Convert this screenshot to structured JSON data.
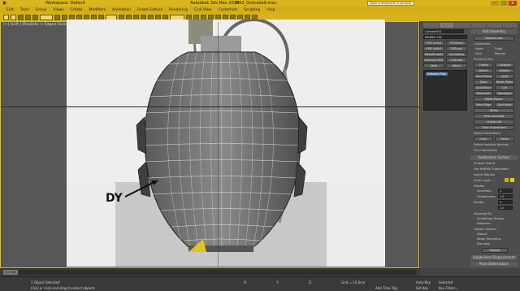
{
  "app": {
    "title": "Autodesk 3ds Max 2016",
    "file": "MK2_Grenade9.max",
    "workspace": "Workspace: Default",
    "search_placeholder": "Type a keyword or phrase"
  },
  "menu": [
    "Edit",
    "Tools",
    "Group",
    "Views",
    "Create",
    "Modifiers",
    "Animation",
    "Graph Editors",
    "Rendering",
    "Civil View",
    "Customize",
    "Scripting",
    "Help"
  ],
  "viewport": {
    "label": "[+] [Left ] [Realistic + Edged Faces ]",
    "annotation": "DY"
  },
  "panel": {
    "object_name": "Cylinder001",
    "modifier_list": "Modifier List",
    "buttons": [
      "FFD 2x2x2",
      "FFD(box)",
      "FFD 3x3x3",
      "FFD(cyl)",
      "TurboSmooth",
      "Symmetry",
      "Unwrap UVW",
      "Chamfer",
      "Shell",
      "Bend"
    ],
    "stack_item": "Editable Poly",
    "edit_geometry": "Edit Geometry",
    "repeat_last": "Repeat Last",
    "constraints": "Constraints",
    "constraint_opts": [
      "None",
      "Edge",
      "Face",
      "Normal"
    ],
    "preserve_uvs": "Preserve UVs",
    "create": "Create",
    "collapse": "Collapse",
    "attach": "Attach",
    "detach": "Detach",
    "slice_plane": "Slice Plane",
    "split": "Split",
    "slice": "Slice",
    "reset_plane": "Reset Plane",
    "quickslice": "QuickSlice",
    "cut": "Cut",
    "msmooth": "MSmooth",
    "tessellate": "Tessellate",
    "make_planar": "Make Planar",
    "view_align": "View Align",
    "grid_align": "Grid Align",
    "relax": "Relax",
    "hide_selected": "Hide Selected",
    "unhide_all": "Unhide All",
    "hide_unselected": "Hide Unselected",
    "named_selections": "Named Selections:",
    "copy": "Copy",
    "paste": "Paste",
    "delete_isolated": "Delete Isolated Vertices",
    "full_interactivity": "Full Interactivity",
    "subdivision_surface": "Subdivision Surface",
    "smooth_result": "Smooth Result",
    "use_nurms": "Use NURMS Subdivision",
    "isoline_display": "Isoline Display",
    "show_cage": "Show Cage......",
    "display": "Display",
    "iterations_label": "Iterations:",
    "iterations": "1",
    "smoothness_label": "Smoothness:",
    "smoothness": "1.0",
    "render": "Render",
    "render_iterations": "0",
    "render_smoothness": "1.0",
    "separate_by": "Separate By",
    "smoothing_groups": "Smoothing Groups",
    "materials": "Materials",
    "update_options": "Update Options",
    "always": "Always",
    "when_rendering": "When Rendering",
    "manually": "Manually",
    "update": "Update",
    "subdivision_displacement": "Subdivision Displacement",
    "paint_deformation": "Paint Deformation",
    "selection": "Selection",
    "by_vertex": "By Vertex",
    "ignore_backfacing": "Ignore Backfacing",
    "by_angle": "By Angle:",
    "angle": "45.0",
    "shrink": "Shrink",
    "grow": "Grow",
    "ring": "Ring",
    "loop": "Loop",
    "preview_selection": "Preview Selection",
    "off": "Off",
    "subobj": "SubObj",
    "multi": "Multi",
    "whole_selected": "Whole Object Selected",
    "soft_selection": "Soft Selection",
    "edit_geometry_tab": "Edit Geometry"
  },
  "timeline": {
    "frame": "0 / 100"
  },
  "status": {
    "selected": "1 Object Selected",
    "prompt": "Click or click-and-drag to select objects",
    "x_label": "X:",
    "y_label": "Y:",
    "z_label": "Z:",
    "grid": "Grid = 10.0cm",
    "add_time_tag": "Add Time Tag",
    "auto_key": "Auto Key",
    "set_key": "Set Key",
    "selected_mode": "Selected",
    "key_filters": "Key Filters..."
  },
  "colors": {
    "accent": "#d9b61e",
    "viewport_border": "#f0c000",
    "panel_bg": "#4d4d4d"
  }
}
